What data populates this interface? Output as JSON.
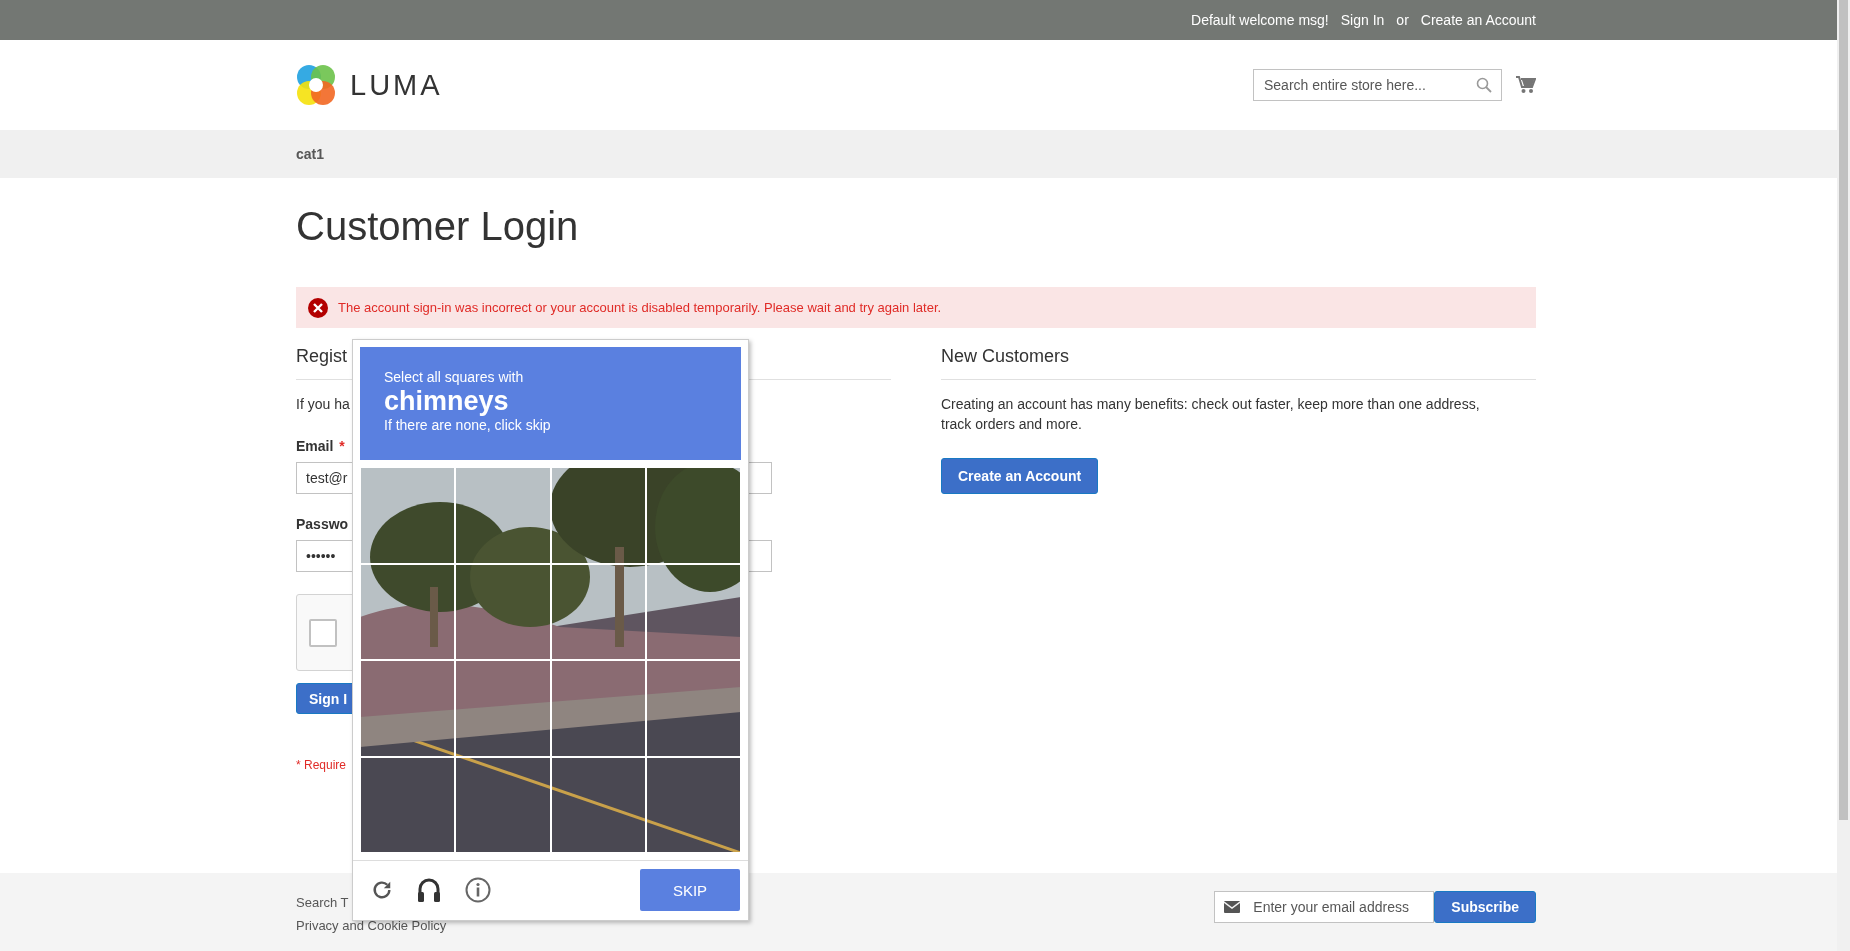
{
  "top_bar": {
    "welcome": "Default welcome msg!",
    "sign_in": "Sign In",
    "separator": "or",
    "create_account": "Create an Account"
  },
  "header": {
    "logo_text": "LUMA",
    "search": {
      "placeholder": "Search entire store here..."
    }
  },
  "nav": {
    "items": [
      "cat1"
    ]
  },
  "page_title": "Customer Login",
  "error_message": "The account sign-in was incorrect or your account is disabled temporarily. Please wait and try again later.",
  "registered": {
    "heading": "Regist",
    "intro": "If you ha",
    "email_label": "Email",
    "required_mark": "*",
    "email_value": "test@r",
    "password_label": "Passwo",
    "password_value": "••••••",
    "recaptcha": {
      "checked": false
    },
    "button": "Sign I",
    "required_note": "* Require"
  },
  "new_customers": {
    "heading": "New Customers",
    "text": "Creating an account has many benefits: check out faster, keep more than one address, track orders and more.",
    "button": "Create an Account"
  },
  "captcha": {
    "instruction": "Select all squares with",
    "target": "chimneys",
    "hint": "If there are none, click skip",
    "tiles": [
      {
        "selected": false
      },
      {
        "selected": false
      },
      {
        "selected": false
      },
      {
        "selected": false
      },
      {
        "selected": false
      },
      {
        "selected": false
      },
      {
        "selected": false
      },
      {
        "selected": false
      },
      {
        "selected": false
      },
      {
        "selected": false
      },
      {
        "selected": false
      },
      {
        "selected": false
      },
      {
        "selected": false
      },
      {
        "selected": false
      },
      {
        "selected": false
      },
      {
        "selected": false
      }
    ],
    "button": "SKIP"
  },
  "footer": {
    "links": [
      "Search T",
      "Privacy and Cookie Policy"
    ],
    "newsletter": {
      "placeholder": "Enter your email address",
      "button": "Subscribe"
    }
  }
}
